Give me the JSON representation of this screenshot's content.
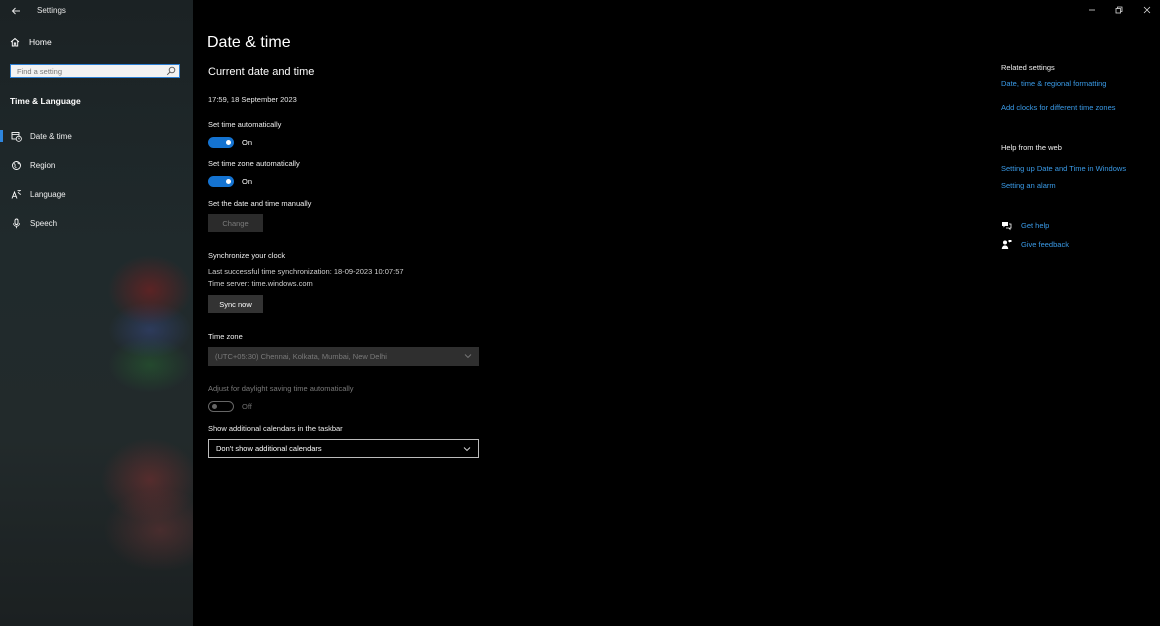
{
  "window": {
    "app_title": "Settings"
  },
  "sidebar": {
    "home_label": "Home",
    "search_placeholder": "Find a setting",
    "section_title": "Time & Language",
    "items": [
      {
        "label": "Date & time",
        "icon": "calendar-clock-icon",
        "active": true
      },
      {
        "label": "Region",
        "icon": "globe-icon",
        "active": false
      },
      {
        "label": "Language",
        "icon": "language-icon",
        "active": false
      },
      {
        "label": "Speech",
        "icon": "microphone-icon",
        "active": false
      }
    ]
  },
  "main": {
    "title": "Date & time",
    "subtitle": "Current date and time",
    "current_datetime": "17:59, 18 September 2023",
    "set_time_auto": {
      "label": "Set time automatically",
      "state": "On"
    },
    "set_timezone_auto": {
      "label": "Set time zone automatically",
      "state": "On"
    },
    "manual": {
      "label": "Set the date and time manually",
      "button": "Change"
    },
    "sync": {
      "heading": "Synchronize your clock",
      "last_sync": "Last successful time synchronization: 18-09-2023 10:07:57",
      "server": "Time server: time.windows.com",
      "button": "Sync now"
    },
    "timezone": {
      "label": "Time zone",
      "value": "(UTC+05:30) Chennai, Kolkata, Mumbai, New Delhi"
    },
    "daylight": {
      "label": "Adjust for daylight saving time automatically",
      "state": "Off"
    },
    "calendars": {
      "label": "Show additional calendars in the taskbar",
      "value": "Don't show additional calendars"
    }
  },
  "right": {
    "related_heading": "Related settings",
    "related_links": [
      "Date, time & regional formatting",
      "Add clocks for different time zones"
    ],
    "help_heading": "Help from the web",
    "help_links": [
      "Setting up Date and Time in Windows",
      "Setting an alarm"
    ],
    "get_help": "Get help",
    "give_feedback": "Give feedback"
  },
  "colors": {
    "accent": "#1473d1",
    "link": "#3a9be8"
  }
}
